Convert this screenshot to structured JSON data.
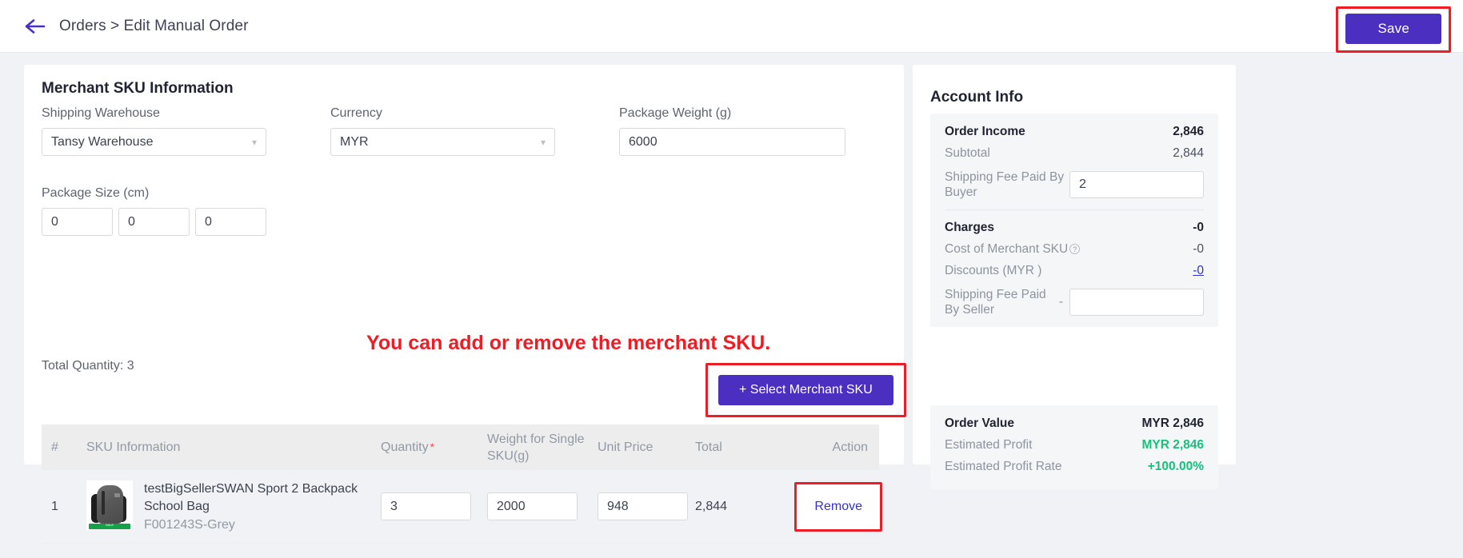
{
  "header": {
    "back_icon": "arrow-left-icon",
    "breadcrumb": "Orders > Edit Manual Order",
    "save_label": "Save"
  },
  "main": {
    "title": "Merchant SKU Information",
    "fields": {
      "shipping_warehouse_label": "Shipping Warehouse",
      "shipping_warehouse_value": "Tansy Warehouse",
      "currency_label": "Currency",
      "currency_value": "MYR",
      "package_weight_label": "Package Weight (g)",
      "package_weight_value": "6000",
      "package_size_label": "Package Size (cm)",
      "package_size_length": "0",
      "package_size_width": "0",
      "package_size_height": "0"
    },
    "annotation": "You can add or remove the merchant SKU.",
    "total_quantity": "Total Quantity: 3",
    "select_sku_button": "+ Select Merchant SKU",
    "table": {
      "columns": [
        "#",
        "SKU Information",
        "Quantity",
        "Weight for Single SKU(g)",
        "Unit Price",
        "Total",
        "Action"
      ],
      "quantity_required_marker": "*",
      "rows": [
        {
          "index": "1",
          "product_name": "testBigSellerSWAN Sport 2 Backpack School Bag",
          "product_code": "F001243S-Grey",
          "thumbnail_badge": "SALE",
          "quantity": "3",
          "weight": "2000",
          "unit_price": "948",
          "total": "2,844",
          "action": "Remove"
        }
      ]
    }
  },
  "account_info": {
    "title": "Account Info",
    "order_income_label": "Order Income",
    "order_income_value": "2,846",
    "subtotal_label": "Subtotal",
    "subtotal_value": "2,844",
    "shipping_fee_buyer_label": "Shipping Fee Paid By Buyer",
    "shipping_fee_buyer_value": "2",
    "charges_label": "Charges",
    "charges_value": "-0",
    "cost_merchant_sku_label": "Cost of Merchant SKU",
    "cost_merchant_sku_value": "-0",
    "discounts_label": "Discounts (MYR )",
    "discounts_value": "-0",
    "shipping_fee_seller_label": "Shipping Fee Paid By Seller",
    "shipping_fee_seller_prefix": "-",
    "shipping_fee_seller_value": "",
    "order_value_label": "Order Value",
    "order_value_value": "MYR 2,846",
    "estimated_profit_label": "Estimated Profit",
    "estimated_profit_value": "MYR 2,846",
    "estimated_profit_rate_label": "Estimated Profit Rate",
    "estimated_profit_rate_value": "+100.00%"
  },
  "colors": {
    "accent_purple": "#4a2fc0",
    "annotation_red": "#ee1c25",
    "link_blue": "#3333cc",
    "profit_green": "#17c07b"
  }
}
